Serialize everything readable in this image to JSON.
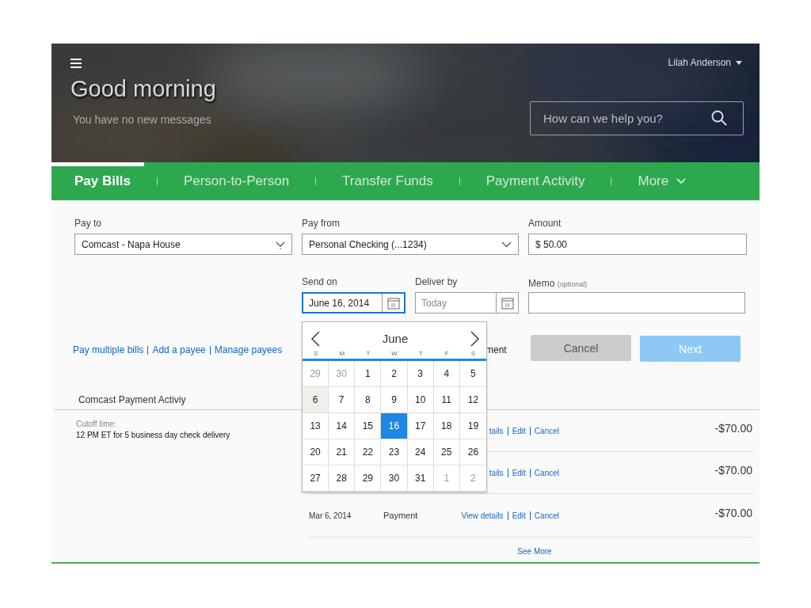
{
  "header": {
    "greeting": "Good morning",
    "subtitle": "You have no new messages",
    "user": "Lilah Anderson",
    "search": {
      "placeholder": "How can we help you?"
    }
  },
  "tabs": [
    {
      "label": "Pay Bills",
      "selected": true,
      "kind": "link"
    },
    {
      "label": "Person-to-Person",
      "selected": false,
      "kind": "link"
    },
    {
      "label": "Transfer Funds",
      "selected": false,
      "kind": "link"
    },
    {
      "label": "Payment Activity",
      "selected": false,
      "kind": "link"
    },
    {
      "label": "More",
      "selected": false,
      "kind": "menu"
    }
  ],
  "form": {
    "pay_to": {
      "label": "Pay to",
      "value": "Comcast - Napa House"
    },
    "pay_from": {
      "label": "Pay from",
      "value": "Personal Checking (...1234)"
    },
    "amount": {
      "label": "Amount",
      "value": "$ 50.00"
    },
    "send_on": {
      "label": "Send on",
      "value": "June 16, 2014",
      "focused": true
    },
    "deliver_by": {
      "label": "Deliver by",
      "placeholder": "Today",
      "focused": false
    },
    "memo": {
      "label": "Memo",
      "hint": "(optional)"
    }
  },
  "links": [
    "Pay multiple bills",
    "Add a payee",
    "Manage payees"
  ],
  "recurring_label": "ment",
  "buttons": [
    {
      "label": "Cancel",
      "disabled": false,
      "kind": "secondary"
    },
    {
      "label": "Next",
      "disabled": true,
      "kind": "primary"
    }
  ],
  "activity": {
    "title": "Comcast Payment Activiy",
    "cutoff_label": "Cutoff time:",
    "cutoff_text": "12 PM ET for 5 business day check delivery",
    "rows": [
      {
        "links": [
          "tails",
          "Edit",
          "Cancel"
        ],
        "amount": "-$70.00"
      },
      {
        "links": [
          "tails",
          "Edit",
          "Cancel"
        ],
        "amount": "-$70.00"
      },
      {
        "date": "Mar 6, 2014",
        "type": "Payment",
        "links": [
          "View details",
          "Edit",
          "Cancel"
        ],
        "amount": "-$70.00"
      }
    ],
    "see_more": "See More"
  },
  "calendar": {
    "month": "June",
    "weekdays": [
      "S",
      "M",
      "T",
      "W",
      "T",
      "F",
      "S"
    ],
    "weeks": [
      [
        {
          "label": "29",
          "kind": "outside",
          "selected": false
        },
        {
          "label": "30",
          "kind": "outside",
          "selected": false
        },
        {
          "label": "1",
          "kind": "day",
          "selected": false
        },
        {
          "label": "2",
          "kind": "day",
          "selected": false
        },
        {
          "label": "3",
          "kind": "day",
          "selected": false
        },
        {
          "label": "4",
          "kind": "day",
          "selected": false
        },
        {
          "label": "5",
          "kind": "day",
          "selected": false
        }
      ],
      [
        {
          "label": "6",
          "kind": "today",
          "selected": false
        },
        {
          "label": "7",
          "kind": "day",
          "selected": false
        },
        {
          "label": "8",
          "kind": "day",
          "selected": false
        },
        {
          "label": "9",
          "kind": "day",
          "selected": false
        },
        {
          "label": "10",
          "kind": "day",
          "selected": false
        },
        {
          "label": "11",
          "kind": "day",
          "selected": false
        },
        {
          "label": "12",
          "kind": "day",
          "selected": false
        }
      ],
      [
        {
          "label": "13",
          "kind": "day",
          "selected": false
        },
        {
          "label": "14",
          "kind": "day",
          "selected": false
        },
        {
          "label": "15",
          "kind": "day",
          "selected": false
        },
        {
          "label": "16",
          "kind": "day",
          "selected": true
        },
        {
          "label": "17",
          "kind": "day",
          "selected": false
        },
        {
          "label": "18",
          "kind": "day",
          "selected": false
        },
        {
          "label": "19",
          "kind": "day",
          "selected": false
        }
      ],
      [
        {
          "label": "20",
          "kind": "day",
          "selected": false
        },
        {
          "label": "21",
          "kind": "day",
          "selected": false
        },
        {
          "label": "22",
          "kind": "day",
          "selected": false
        },
        {
          "label": "23",
          "kind": "day",
          "selected": false
        },
        {
          "label": "24",
          "kind": "day",
          "selected": false
        },
        {
          "label": "25",
          "kind": "day",
          "selected": false
        },
        {
          "label": "26",
          "kind": "day",
          "selected": false
        }
      ],
      [
        {
          "label": "27",
          "kind": "day",
          "selected": false
        },
        {
          "label": "28",
          "kind": "day",
          "selected": false
        },
        {
          "label": "29",
          "kind": "day",
          "selected": false
        },
        {
          "label": "30",
          "kind": "day",
          "selected": false
        },
        {
          "label": "31",
          "kind": "day",
          "selected": false
        },
        {
          "label": "1",
          "kind": "outside",
          "selected": false
        },
        {
          "label": "2",
          "kind": "outside",
          "selected": false
        }
      ]
    ]
  }
}
